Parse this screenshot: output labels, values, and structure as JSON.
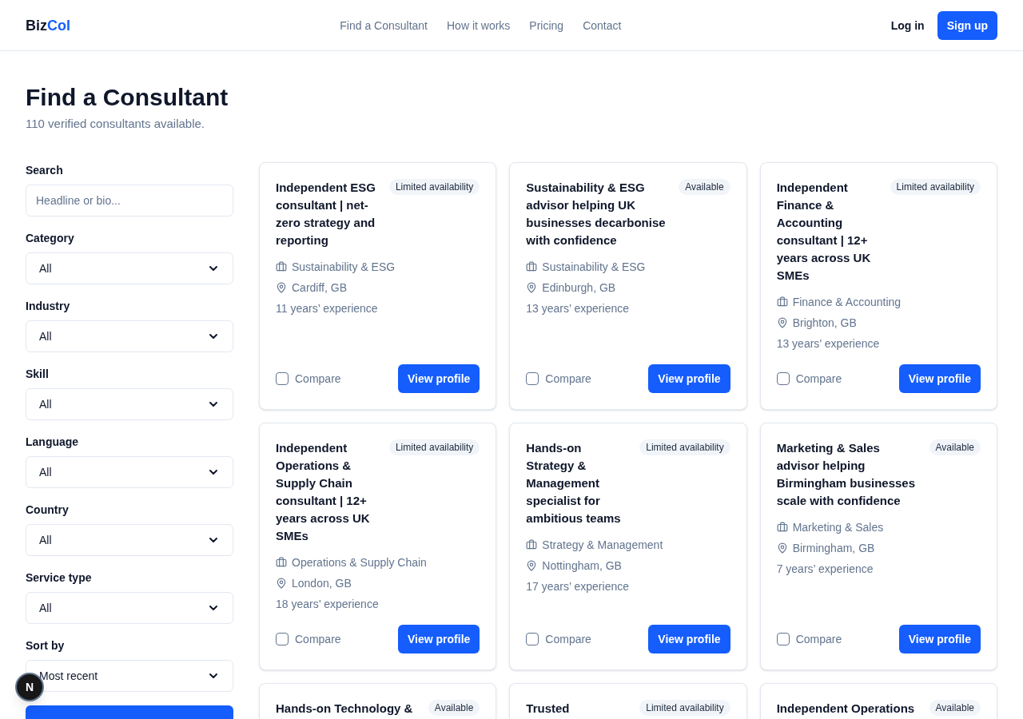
{
  "header": {
    "logo_dark": "Biz",
    "logo_accent": "Col",
    "nav": [
      {
        "label": "Find a Consultant"
      },
      {
        "label": "How it works"
      },
      {
        "label": "Pricing"
      },
      {
        "label": "Contact"
      }
    ],
    "login": "Log in",
    "signup": "Sign up"
  },
  "page": {
    "title": "Find a Consultant",
    "subtitle": "110 verified consultants available."
  },
  "filters": [
    {
      "kind": "text",
      "label": "Search",
      "placeholder": "Headline or bio..."
    },
    {
      "kind": "select",
      "label": "Category",
      "value": "All"
    },
    {
      "kind": "select",
      "label": "Industry",
      "value": "All"
    },
    {
      "kind": "select",
      "label": "Skill",
      "value": "All"
    },
    {
      "kind": "select",
      "label": "Language",
      "value": "All"
    },
    {
      "kind": "select",
      "label": "Country",
      "value": "All"
    },
    {
      "kind": "select",
      "label": "Service type",
      "value": "All"
    },
    {
      "kind": "select",
      "label": "Sort by",
      "value": "Most recent"
    }
  ],
  "dev_badge": "N",
  "cards": [
    {
      "title": "Independent ESG consultant | net-zero strategy and reporting",
      "availability": "Limited availability",
      "category": "Sustainability & ESG",
      "location": "Cardiff, GB",
      "experience": "11 years’ experience",
      "compare_label": "Compare",
      "compare": false,
      "button": "View profile"
    },
    {
      "title": "Sustainability & ESG advisor helping UK businesses decarbonise with confidence",
      "availability": "Available",
      "category": "Sustainability & ESG",
      "location": "Edinburgh, GB",
      "experience": "13 years’ experience",
      "compare_label": "Compare",
      "compare": false,
      "button": "View profile"
    },
    {
      "title": "Independent Finance & Accounting consultant | 12+ years across UK SMEs",
      "availability": "Limited availability",
      "category": "Finance & Accounting",
      "location": "Brighton, GB",
      "experience": "13 years’ experience",
      "compare_label": "Compare",
      "compare": false,
      "button": "View profile"
    },
    {
      "title": "Independent Operations & Supply Chain consultant | 12+ years across UK SMEs",
      "availability": "Limited availability",
      "category": "Operations & Supply Chain",
      "location": "London, GB",
      "experience": "18 years’ experience",
      "compare_label": "Compare",
      "compare": false,
      "button": "View profile"
    },
    {
      "title": "Hands-on Strategy & Management specialist for ambitious teams",
      "availability": "Limited availability",
      "category": "Strategy & Management",
      "location": "Nottingham, GB",
      "experience": "17 years’ experience",
      "compare_label": "Compare",
      "compare": false,
      "button": "View profile"
    },
    {
      "title": "Marketing & Sales advisor helping Birmingham businesses scale with confidence",
      "availability": "Available",
      "category": "Marketing & Sales",
      "location": "Birmingham, GB",
      "experience": "7 years’ experience",
      "compare_label": "Compare",
      "compare": false,
      "button": "View profile"
    },
    {
      "title": "Hands-on Technology &",
      "availability": "Available"
    },
    {
      "title": "Trusted",
      "availability": "Limited availability"
    },
    {
      "title": "Independent Operations",
      "availability": "Available"
    }
  ]
}
